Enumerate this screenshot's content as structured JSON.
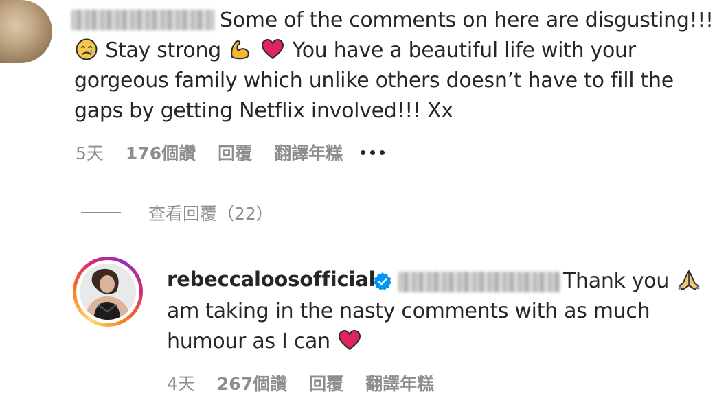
{
  "comment": {
    "username": "",
    "line_1": "Some of the comments on here are disgusting!!!",
    "text_a": "Stay strong",
    "text_b": "You have a beautiful life with your gorgeous family which unlike others doesn’t have to fill the gaps by getting Netflix involved!!! Xx",
    "emojis": [
      "crying-face-icon",
      "flexed-biceps-icon",
      "red-heart-icon"
    ],
    "time": "5天",
    "likes": "176個讚",
    "reply_label": "回覆",
    "translate_label": "翻譯年糕",
    "more_icon": "more-horizontal-icon"
  },
  "view_replies": {
    "label": "查看回覆（22）"
  },
  "reply": {
    "username": "rebeccaloosofficial",
    "verified_icon": "verified-badge-icon",
    "text_a": "Thank you",
    "text_b": "am taking in the nasty comments with as much humour as I can",
    "emojis": [
      "folded-hands-icon",
      "red-heart-icon"
    ],
    "time": "4天",
    "likes": "267個讚",
    "reply_label": "回覆",
    "translate_label": "翻譯年糕"
  },
  "colors": {
    "text": "#262626",
    "secondary": "#8e8e8e",
    "verified": "#0095f6",
    "heart": "#e0245e"
  }
}
